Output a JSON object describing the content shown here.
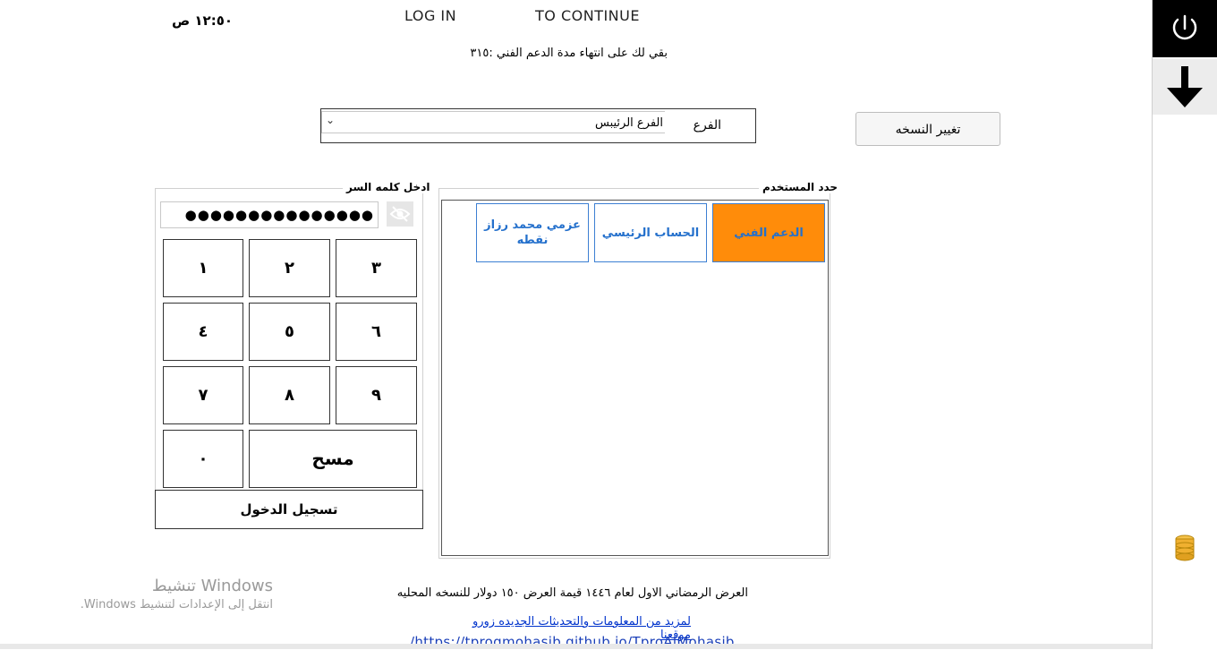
{
  "header": {
    "time": "١٢:٥٠ ص",
    "login": "LOG IN",
    "to_continue": "TO CONTINUE",
    "support_remaining": "بقي لك على انتهاء مدة الدعم الفني  :٣١٥"
  },
  "branch": {
    "label": "الفرع",
    "selected": "الفرع الرئيبس"
  },
  "change_version_label": "تغيير النسخه",
  "password": {
    "legend": "ادخل كلمه السر",
    "masked_value": "●●●●●●●●●●●●●●●"
  },
  "keypad": {
    "k1": "١",
    "k2": "٢",
    "k3": "٣",
    "k4": "٤",
    "k5": "٥",
    "k6": "٦",
    "k7": "٧",
    "k8": "٨",
    "k9": "٩",
    "k0": "٠",
    "clear": "مسح"
  },
  "login_button": "تسجيل الدخول",
  "users": {
    "legend": "حدد المستخدم",
    "items": [
      {
        "label": "الدعم الفني",
        "selected": true
      },
      {
        "label": "الحساب الرئيسي",
        "selected": false
      },
      {
        "label": "عزمي محمد رزاز نقطه",
        "selected": false
      }
    ]
  },
  "footer": {
    "offer": "العرض الرمضاني الاول لعام ١٤٤٦ قيمة العرض ١٥٠ دولار للنسخه المحليه",
    "more_info": "لمزيد من المعلومات والتحديثات الجديده زورو موقعنا",
    "url": "/https://tprogmohasib.github.io/TproAlMohasib"
  },
  "windows_activation": {
    "title": "تنشيط Windows",
    "subtitle": "انتقل إلى الإعدادات لتنشيط Windows."
  },
  "sidebar": {
    "power_icon": "power-icon",
    "download_icon": "arrow-down-icon",
    "database_icon": "database-icon"
  },
  "colors": {
    "selected_user_bg": "#ff8c0a",
    "user_button_text": "#2470cc",
    "link": "#0033cc"
  }
}
